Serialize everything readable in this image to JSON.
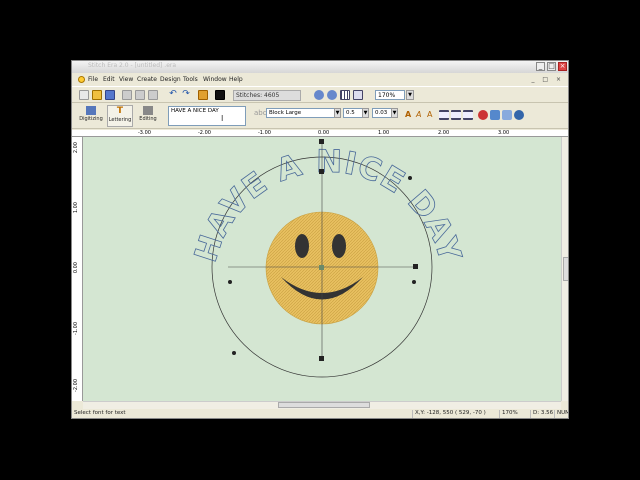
{
  "window": {
    "title": "Stitch Era 2.0 - [untitled] .era"
  },
  "menu": {
    "items": [
      {
        "label": "File"
      },
      {
        "label": "Edit"
      },
      {
        "label": "View"
      },
      {
        "label": "Create"
      },
      {
        "label": "Design"
      },
      {
        "label": "Tools"
      },
      {
        "label": "Window"
      },
      {
        "label": "Help"
      }
    ],
    "controls": "_ □ ×"
  },
  "toolbar": {
    "stitches": "Stitches: 4605",
    "zoom": "170%"
  },
  "modes": [
    {
      "label": "Digitizing"
    },
    {
      "label": "Lettering"
    },
    {
      "label": "Editing"
    }
  ],
  "lettering": {
    "text": "HAVE A NICE DAY",
    "font": "Block Large",
    "size1": "0.5 ",
    "size2": "0.03 "
  },
  "ruler_h": [
    "-3.00",
    "-2.00",
    "-1.00",
    "0.00",
    "1.00",
    "2.00",
    "3.00"
  ],
  "ruler_v": [
    "2.00",
    "1.00",
    "0.00",
    "-1.00",
    "-2.00"
  ],
  "canvas": {
    "arc_text": "HAVE A NICE DAY"
  },
  "status": {
    "hint": "Select font for text",
    "coords": "X,Y: -128, 550  ( 529, -70 )",
    "zoom": "170%",
    "dist": "D: 3.56",
    "num": "NUM"
  },
  "colors": {
    "canvas_bg": "#d4e6d2",
    "smiley_fill": "#e8c060",
    "outline": "#4a6a9a"
  }
}
